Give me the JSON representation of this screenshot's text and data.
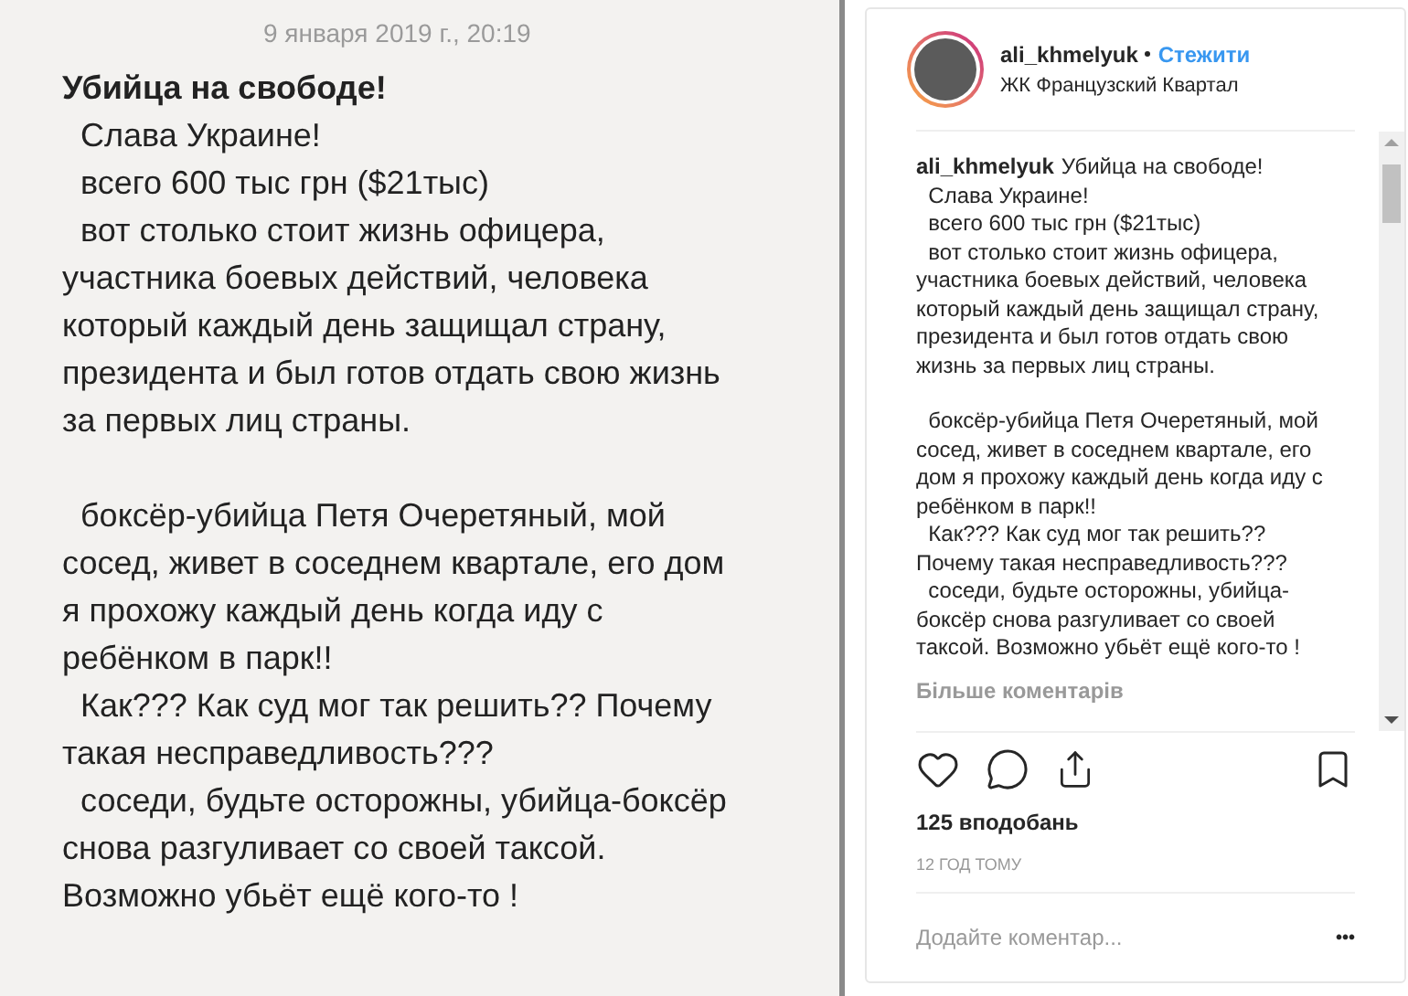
{
  "note": {
    "date": "9 января 2019 г., 20:19",
    "title": "Убийца на свободе!",
    "paragraphs": [
      [
        "  Слава Украине!",
        "  всего 600 тыс грн ($21тыс)",
        "  вот столько стоит жизнь офицера,",
        "участника боевых действий, человека",
        "который каждый день защищал страну,",
        "президента и был готов отдать свою жизнь",
        "за первых лиц страны."
      ],
      [
        "  боксёр-убийца Петя Очеретяный, мой",
        "сосед, живет в соседнем квартале, его дом",
        "я прохожу каждый день когда иду с",
        "ребёнком в парк!!",
        "  Как??? Как суд мог так решить?? Почему",
        "такая несправедливость???",
        "  соседи, будьте осторожны, убийца-боксёр",
        "снова разгуливает со своей таксой.",
        "Возможно убьёт ещё кого-то !"
      ]
    ]
  },
  "post": {
    "username": "ali_khmelyuk",
    "follow": "Стежити",
    "location": "ЖК Французский Квартал",
    "caption_author": "ali_khmelyuk",
    "caption_paragraphs": [
      [
        "Убийца на свободе!",
        "  Слава Украине!",
        "  всего 600 тыс грн ($21тыс)",
        "  вот столько стоит жизнь офицера,",
        "участника боевых действий, человека",
        "который каждый день защищал страну,",
        "президента и был готов отдать свою",
        "жизнь за первых лиц страны."
      ],
      [
        "  боксёр-убийца Петя Очеретяный, мой",
        "сосед, живет в соседнем квартале, его",
        "дом я прохожу каждый день когда иду с",
        "ребёнком в парк!!",
        "  Как??? Как суд мог так решить??",
        "Почему такая несправедливость???",
        "  соседи, будьте осторожны, убийца-",
        "боксёр снова разгуливает со своей",
        "таксой. Возможно убьёт ещё кого-то !"
      ]
    ],
    "more_comments": "Більше коментарів",
    "likes": "125 вподобань",
    "time": "12 ГОД ТОМУ",
    "comment_placeholder": "Додайте коментар...",
    "more": "•••"
  }
}
